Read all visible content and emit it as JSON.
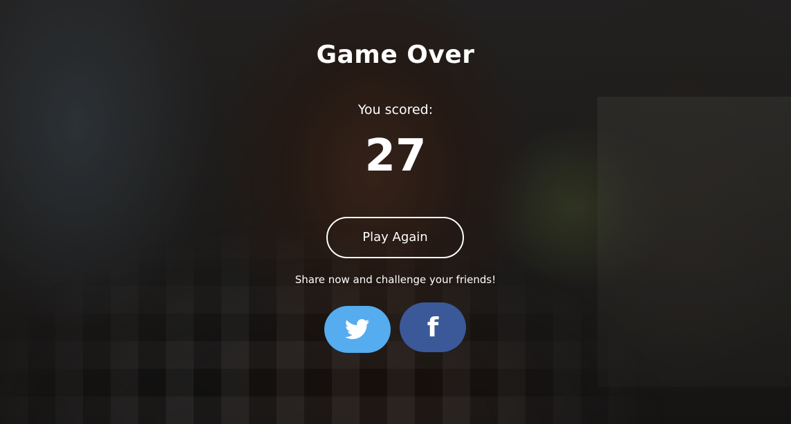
{
  "game_over": {
    "title": "Game Over",
    "scored_label": "You scored:",
    "score": "27",
    "play_again_label": "Play Again",
    "share_text": "Share now and challenge your friends!"
  },
  "share": {
    "twitter": {
      "icon": "twitter-bird-icon",
      "color": "#55acee"
    },
    "facebook": {
      "icon": "facebook-f-icon",
      "glyph": "f",
      "color": "#3b5998"
    }
  },
  "colors": {
    "text": "#ffffff",
    "button_border": "#ffffff"
  }
}
